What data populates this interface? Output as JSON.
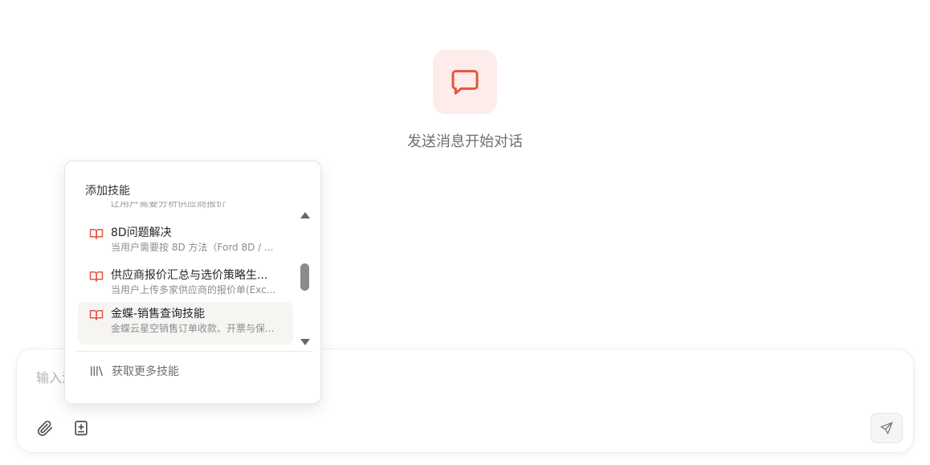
{
  "empty_state": {
    "message": "发送消息开始对话"
  },
  "composer": {
    "placeholder": "输入消息..."
  },
  "skill_popover": {
    "title": "添加技能",
    "partial_item": "让用户需要分析供应商报价",
    "items": [
      {
        "name": "8D问题解决",
        "desc": "当用户需要按 8D 方法（Ford 8D / ..."
      },
      {
        "name": "供应商报价汇总与选价策略生...",
        "desc": "当用户上传多家供应商的报价单(Exc..."
      },
      {
        "name": "金蝶-销售查询技能",
        "desc": "金蝶云星空销售订单收款、开票与保..."
      }
    ],
    "more_label": "获取更多技能"
  },
  "colors": {
    "accent": "#e8533f",
    "accent_bg": "#fdece9",
    "active_item_bg": "#f7f5f2"
  },
  "icons": {
    "empty_state": "chat-bubble-icon",
    "skill": "book-open-icon",
    "more": "library-icon",
    "attach": "paperclip-icon",
    "skill_toggle": "plus-square-icon",
    "send": "send-icon"
  }
}
